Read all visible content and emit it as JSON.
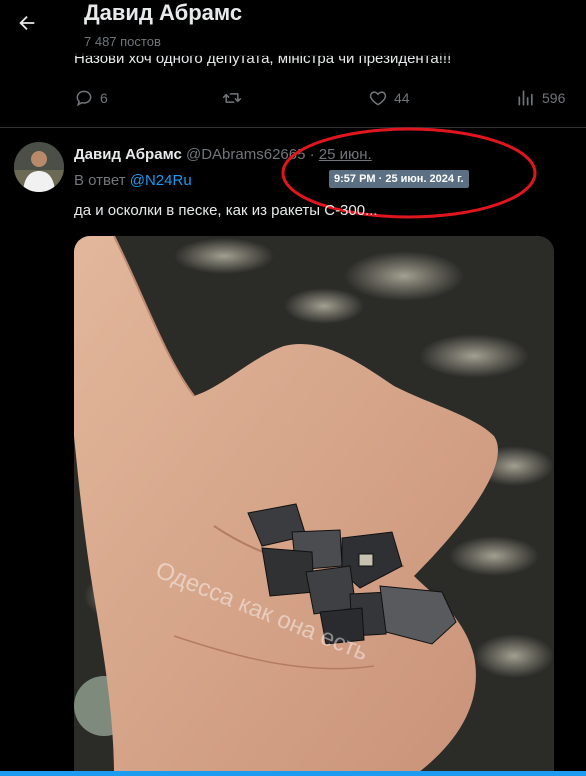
{
  "header": {
    "title": "Давид Абрамс",
    "posts_count": "7 487 постов"
  },
  "previous_post": {
    "text": "Назови хоч одного депутата, міністра чи президента!!!",
    "replies": "6",
    "likes": "44",
    "views": "596"
  },
  "tweet": {
    "author_name": "Давид Абрамс",
    "author_handle": "@DAbrams62665",
    "separator": "·",
    "date": "25 июн.",
    "tooltip": "9:57 PM · 25 июн. 2024 г.",
    "reply_prefix": "В ответ",
    "reply_to": "@N24Ru",
    "text": "да и осколки в песке, как из ракеты С-300...",
    "image_watermark": "Одесса как она есть"
  },
  "colors": {
    "background": "#000000",
    "text": "#e7e9ea",
    "muted": "#71767b",
    "link": "#1d9bf0",
    "annotation": "#e0161e"
  },
  "icons": {
    "back": "arrow-left-icon",
    "reply": "reply-icon",
    "repost": "repost-icon",
    "like": "heart-icon",
    "views": "views-icon"
  }
}
